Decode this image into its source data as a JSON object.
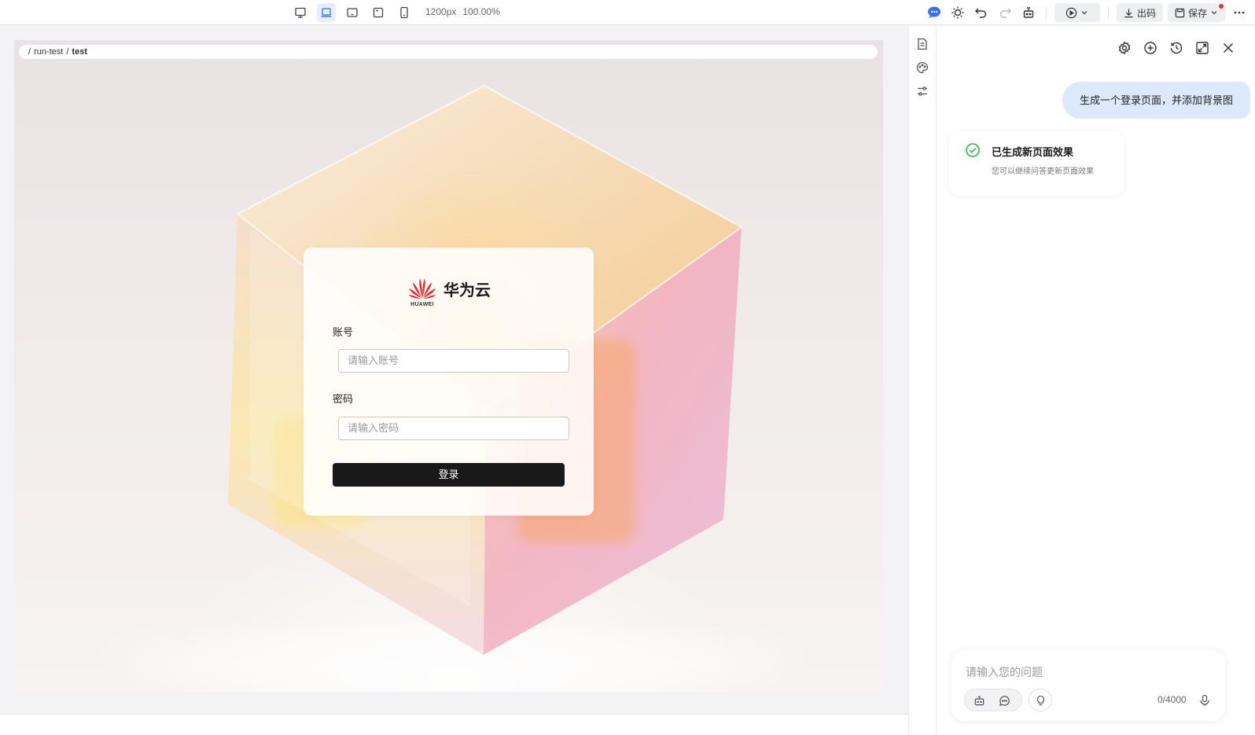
{
  "toolbar": {
    "device_buttons": [
      {
        "name": "desktop-view",
        "active": false
      },
      {
        "name": "laptop-view",
        "active": true
      },
      {
        "name": "tablet-landscape-view",
        "active": false
      },
      {
        "name": "tablet-view",
        "active": false
      },
      {
        "name": "mobile-view",
        "active": false
      }
    ],
    "width_text": "1200px",
    "zoom_text": "100.00%",
    "export_label": "出码",
    "save_label": "保存"
  },
  "preview": {
    "breadcrumb": {
      "separator": "/",
      "parent": "run-test",
      "current": "test"
    },
    "login": {
      "brand_text": "华为云",
      "brand_sub": "HUAWEI",
      "account_label": "账号",
      "account_placeholder": "请输入账号",
      "password_label": "密码",
      "password_placeholder": "请输入密码",
      "submit_label": "登录"
    }
  },
  "chat": {
    "user_message": "生成一个登录页面，并添加背景图",
    "bot_title": "已生成新页面效果",
    "bot_subtitle": "您可以继续问答更新页面效果",
    "input_placeholder": "请输入您的问题",
    "counter": "0/4000"
  },
  "colors": {
    "accent": "#2d6cdf",
    "brand_red": "#e3262f",
    "success": "#2fb344",
    "user_bubble": "#dbe9fb",
    "primary_button": "#191919"
  }
}
